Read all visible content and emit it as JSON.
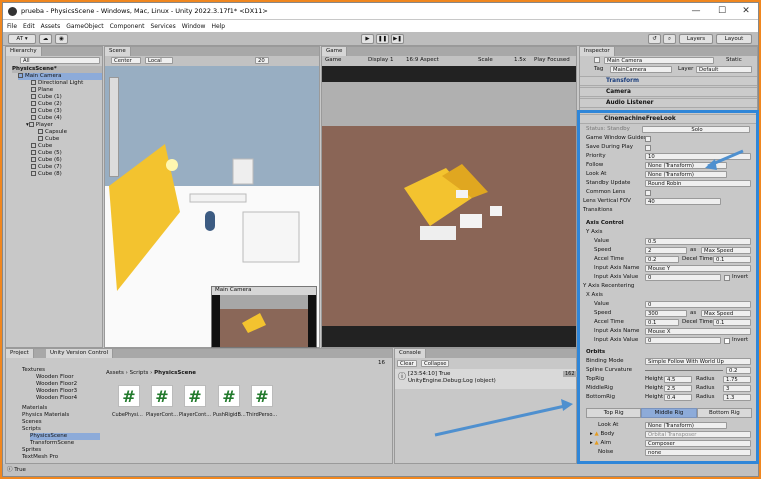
{
  "window": {
    "title": "prueba - PhysicsScene - Windows, Mac, Linux - Unity 2022.3.17f1* <DX11>",
    "minimize": "—",
    "maximize": "☐",
    "close": "✕"
  },
  "menu": [
    "File",
    "Edit",
    "Assets",
    "GameObject",
    "Component",
    "Services",
    "Window",
    "Help"
  ],
  "toolbar": {
    "account": "AT ▾",
    "layers": "Layers",
    "layout": "Layout"
  },
  "hierarchy": {
    "tab": "Hierarchy",
    "search_placeholder": "All",
    "scene": "PhysicsScene*",
    "items": [
      "Main Camera",
      "Directional Light",
      "Plane",
      "Cube (1)",
      "Cube (2)",
      "Cube (3)",
      "Cube (4)",
      "Player",
      "Capsule",
      "Cube",
      "Cube",
      "Cube (5)",
      "Cube (6)",
      "Cube (7)",
      "Cube (8)"
    ]
  },
  "scene": {
    "tab": "Scene",
    "pivot": "Center",
    "space": "Local",
    "gizmo_num": "20",
    "cam_preview": "Main Camera"
  },
  "game": {
    "tab": "Game",
    "mode": "Game",
    "display": "Display 1",
    "aspect": "16:9 Aspect",
    "scale_label": "Scale",
    "scale_value": "1.5x",
    "play": "Play Focused"
  },
  "project": {
    "tab": "Project",
    "vc_tab": "Unity Version Control",
    "path": [
      "Assets",
      "Scripts",
      "PhysicsScene"
    ],
    "tree": [
      "Textures",
      "Wooden Floor",
      "Wooden Floor2",
      "Wooden Floor3",
      "Wooden Floor4",
      "Materials",
      "Physics Materials",
      "Scenes",
      "Scripts",
      "PhysicsScene",
      "TransformScene",
      "Sprites",
      "TextMesh Pro",
      "Textures"
    ],
    "files": [
      "CubePhysi...",
      "PlayerCont...",
      "PlayerCont...",
      "PushRigidB...",
      "ThirdPerso..."
    ],
    "count": "16"
  },
  "console": {
    "tab": "Console",
    "clear": "Clear",
    "collapse": "Collapse",
    "log_time": "[23:54:10] True",
    "log_src": "UnityEngine.Debug:Log (object)",
    "badge": "162"
  },
  "status": {
    "text": "True"
  },
  "inspector": {
    "tab": "Inspector",
    "object": "Main Camera",
    "static": "Static",
    "tag_label": "Tag",
    "tag": "MainCamera",
    "layer_label": "Layer",
    "layer": "Default",
    "components": [
      "Transform",
      "Camera",
      "Audio Listener"
    ],
    "cm": {
      "name": "CinemachineFreeLook",
      "status_label": "Status: Standby",
      "solo": "Solo",
      "guides": "Game Window Guides",
      "save": "Save During Play",
      "priority_label": "Priority",
      "priority": "10",
      "follow_label": "Follow",
      "follow": "None (Transform)",
      "lookat_label": "Look At",
      "lookat": "None (Transform)",
      "standby_label": "Standby Update",
      "standby": "Round Robin",
      "common_lens": "Common Lens",
      "fov_label": "Lens Vertical FOV",
      "fov": "40",
      "transitions": "Transitions",
      "axis_control": "Axis Control",
      "yaxis": {
        "title": "Y Axis",
        "value_label": "Value",
        "value": "0.5",
        "speed_label": "Speed",
        "speed": "2",
        "as": "as",
        "speed_mode": "Max Speed",
        "accel_label": "Accel Time",
        "accel": "0.2",
        "decel_label": "Decel Time",
        "decel": "0.1",
        "name_label": "Input Axis Name",
        "name": "Mouse Y",
        "ival_label": "Input Axis Value",
        "ival": "0",
        "invert": "Invert"
      },
      "recenter": "Y Axis Recentering",
      "xaxis": {
        "title": "X Axis",
        "value_label": "Value",
        "value": "0",
        "speed_label": "Speed",
        "speed": "300",
        "as": "as",
        "speed_mode": "Max Speed",
        "accel_label": "Accel Time",
        "accel": "0.1",
        "decel_label": "Decel Time",
        "decel": "0.1",
        "name_label": "Input Axis Name",
        "name": "Mouse X",
        "ival_label": "Input Axis Value",
        "ival": "0",
        "invert": "Invert"
      },
      "orbits": "Orbits",
      "binding_label": "Binding Mode",
      "binding": "Simple Follow With World Up",
      "spline_label": "Spline Curvature",
      "spline": "0.2",
      "rigs": [
        {
          "label": "TopRig",
          "height": "4.5",
          "radius": "1.75"
        },
        {
          "label": "MiddleRig",
          "height": "2.5",
          "radius": "3"
        },
        {
          "label": "BottomRig",
          "height": "0.4",
          "radius": "1.3"
        }
      ],
      "height_label": "Height",
      "radius_label": "Radius",
      "rigtabs": [
        "Top Rig",
        "Middle Rig",
        "Bottom Rig"
      ],
      "rig_lookat_label": "Look At",
      "rig_lookat": "None (Transform)",
      "body_label": "Body",
      "body": "Orbital Transposer",
      "aim_label": "Aim",
      "aim": "Composer",
      "noise_label": "Noise",
      "noise": "none"
    }
  },
  "colors": {
    "accent_border": "#2f86d8",
    "arrow": "#4f90cf",
    "frame": "#f0871f"
  }
}
